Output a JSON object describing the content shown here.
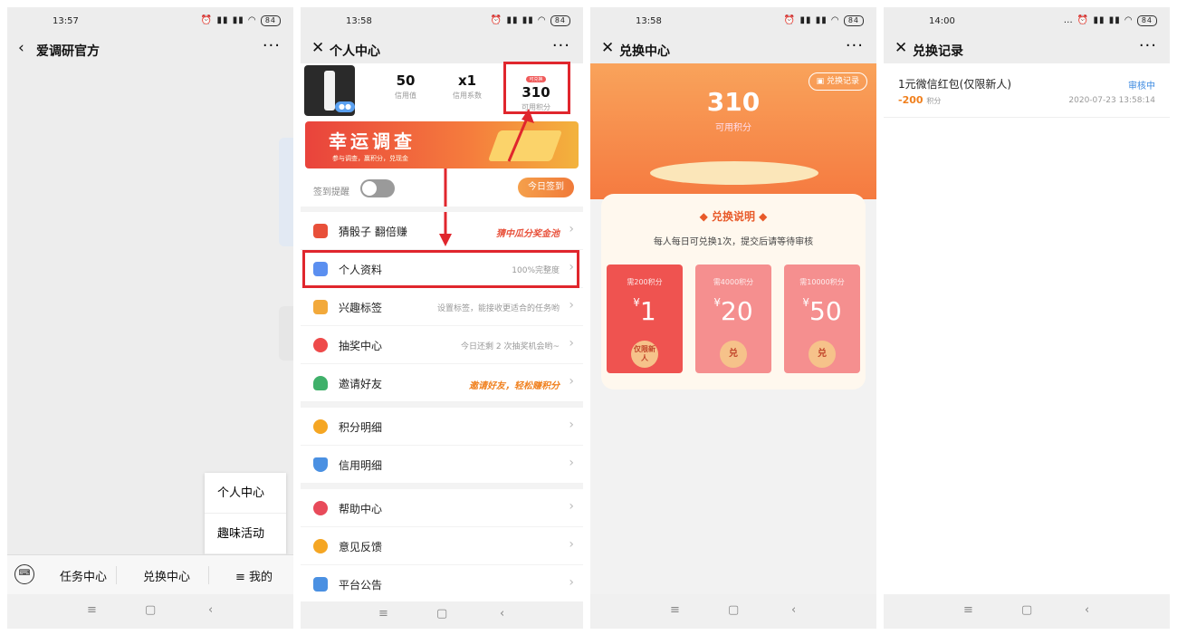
{
  "panel1": {
    "time": "13:57",
    "battery": "84",
    "back_icon": "back-chevron-icon",
    "title": "爱调研官方",
    "more": "···",
    "popup_items": [
      "个人中心",
      "趣味活动"
    ],
    "bottom_tabs": [
      "任务中心",
      "兑换中心",
      "≡ 我的"
    ]
  },
  "panel2": {
    "time": "13:58",
    "battery": "84",
    "title": "个人中心",
    "more": "···",
    "stats": [
      {
        "value": "50",
        "label": "信用值"
      },
      {
        "value": "x1",
        "label": "信用系数"
      },
      {
        "value": "310",
        "label": "可用积分",
        "tag": "可兑换"
      }
    ],
    "banner": {
      "title": "幸运调查",
      "subtitle": "参与调查，赢积分，兑现金"
    },
    "sign_label": "签到提醒",
    "sign_button": "今日签到",
    "rows": [
      {
        "name": "猜骰子 翻倍赚",
        "hint": "猜中瓜分奖金池",
        "icon": "dice-icon",
        "color": "#e8503a"
      },
      {
        "name": "个人资料",
        "hint": "100%完整度",
        "icon": "clipboard-icon",
        "color": "#5b8ff0"
      },
      {
        "name": "兴趣标签",
        "hint": "设置标签，能接收更适合的任务哟",
        "icon": "tag-icon",
        "color": "#f2a93b"
      },
      {
        "name": "抽奖中心",
        "hint": "今日还剩 2 次抽奖机会哟~",
        "icon": "prize-wheel-icon",
        "color": "#ee4a4a"
      },
      {
        "name": "邀请好友",
        "hint": "邀请好友，轻松赚积分",
        "icon": "person-add-icon",
        "color": "#3fb06a"
      },
      {
        "name": "积分明细",
        "hint": "",
        "icon": "coin-icon",
        "color": "#f5a623"
      },
      {
        "name": "信用明细",
        "hint": "",
        "icon": "shield-icon",
        "color": "#4a90e2"
      },
      {
        "name": "帮助中心",
        "hint": "",
        "icon": "heart-icon",
        "color": "#e84a5a"
      },
      {
        "name": "意见反馈",
        "hint": "",
        "icon": "chat-icon",
        "color": "#f5a623"
      },
      {
        "name": "平台公告",
        "hint": "",
        "icon": "megaphone-icon",
        "color": "#4a90e2"
      }
    ]
  },
  "panel3": {
    "time": "13:58",
    "battery": "84",
    "title": "兑换中心",
    "more": "···",
    "points": "310",
    "points_label": "可用积分",
    "record_button": "兑换记录",
    "section_title": "兑换说明",
    "section_desc": "每人每日可兑换1次，提交后请等待审核",
    "tiles": [
      {
        "need": "需200积分",
        "amount": "1",
        "pill": "仅限新人",
        "bg": "#ef5350"
      },
      {
        "need": "需4000积分",
        "amount": "20",
        "pill": "兑",
        "bg": "#f58f8f"
      },
      {
        "need": "需10000积分",
        "amount": "50",
        "pill": "兑",
        "bg": "#f58f8f"
      }
    ]
  },
  "panel4": {
    "time": "14:00",
    "battery": "84",
    "title": "兑换记录",
    "more": "···",
    "record": {
      "name": "1元微信红包(仅限新人)",
      "status": "审核中",
      "amount": "-200",
      "unit": "积分",
      "datetime": "2020-07-23 13:58:14"
    }
  },
  "sysbar": {
    "menu": "≡",
    "home": "▢",
    "back": "‹"
  },
  "colors": {
    "accent": "#f57a40",
    "highlight_box": "#e0262d",
    "status_blue": "#3a88e0"
  }
}
